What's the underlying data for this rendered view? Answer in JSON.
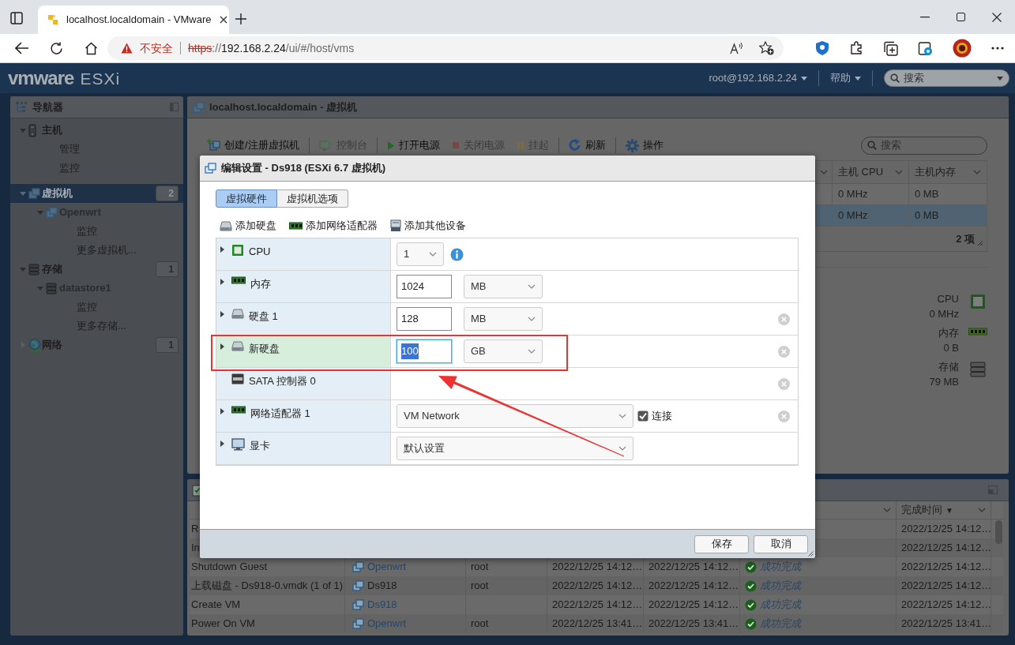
{
  "browser": {
    "tab": {
      "title": "localhost.localdomain - VMware"
    },
    "address": {
      "security": "不安全",
      "scheme": "https",
      "after_scheme": "://",
      "host": "192.168.2.24",
      "path": "/ui/#/host/vms"
    }
  },
  "header": {
    "logo": "vmware",
    "product": "ESXi",
    "user": "root@192.168.2.24",
    "help": "帮助",
    "search_placeholder": "搜索"
  },
  "navigator": {
    "title": "导航器",
    "items": [
      {
        "label": "主机",
        "kind": "host",
        "selected": false,
        "expanded": true,
        "children": [
          {
            "label": "管理",
            "selected": false
          },
          {
            "label": "监控",
            "selected": false
          }
        ]
      },
      {
        "label": "虚拟机",
        "kind": "vm",
        "selected": true,
        "expanded": true,
        "count": "2",
        "children": [
          {
            "label": "Openwrt",
            "kind": "vm",
            "selected": false,
            "expanded": true,
            "children": [
              {
                "label": "监控",
                "selected": false
              },
              {
                "label": "更多虚拟机...",
                "selected": false
              }
            ]
          }
        ]
      },
      {
        "label": "存储",
        "kind": "storage",
        "selected": false,
        "expanded": true,
        "count": "1",
        "children": [
          {
            "label": "datastore1",
            "kind": "storage",
            "selected": false,
            "expanded": true,
            "children": [
              {
                "label": "监控",
                "selected": false
              },
              {
                "label": "更多存储...",
                "selected": false
              }
            ]
          }
        ]
      },
      {
        "label": "网络",
        "kind": "network",
        "selected": false,
        "expanded": false,
        "count": "1"
      }
    ]
  },
  "main": {
    "title": "localhost.localdomain - 虚拟机",
    "toolbar": [
      {
        "label": "创建/注册虚拟机",
        "kind": "create",
        "disabled": false,
        "separator_after": true
      },
      {
        "label": "控制台",
        "kind": "console",
        "disabled": true,
        "separator_after": true
      },
      {
        "label": "打开电源",
        "kind": "power_on",
        "disabled": false,
        "separator_after": false
      },
      {
        "label": "关闭电源",
        "kind": "power_off",
        "disabled": true,
        "separator_after": false
      },
      {
        "label": "挂起",
        "kind": "suspend",
        "disabled": true,
        "separator_after": true
      },
      {
        "label": "刷新",
        "kind": "refresh",
        "disabled": false,
        "separator_after": true
      },
      {
        "label": "操作",
        "kind": "actions",
        "disabled": false,
        "separator_after": false
      }
    ],
    "search_placeholder": "搜索",
    "vm_table": {
      "columns": [
        "主机 CPU",
        "主机内存"
      ],
      "rows": [
        {
          "cells": [
            "0 MHz",
            "0 MB"
          ],
          "selected": false
        },
        {
          "cells": [
            "0 MHz",
            "0 MB"
          ],
          "selected": true
        }
      ],
      "footer": "2 项"
    },
    "summary": [
      {
        "label": "CPU",
        "value": "0 MHz",
        "kind": "cpu"
      },
      {
        "label": "内存",
        "value": "0 B",
        "kind": "memory"
      },
      {
        "label": "存储",
        "value": "79 MB",
        "kind": "storage"
      }
    ]
  },
  "tasks": {
    "columns": [
      {
        "label": "完成时间",
        "sort": "▼"
      }
    ],
    "rows": [
      {
        "task": "R",
        "completed": "2022/12/25 14:12…"
      },
      {
        "task": "In",
        "completed": "2022/12/25 14:12…"
      },
      {
        "task": "Shutdown Guest",
        "target": "Openwrt",
        "target_link": true,
        "initiator": "root",
        "queued": "2022/12/25 14:12…",
        "started": "2022/12/25 14:12…",
        "result": "成功完成",
        "completed": "2022/12/25 14:12…"
      },
      {
        "task": "上载磁盘 - Ds918-0.vmdk (1 of 1)",
        "target": "Ds918",
        "target_link": false,
        "initiator": "root",
        "queued": "2022/12/25 14:12…",
        "started": "2022/12/25 14:12…",
        "result": "成功完成",
        "completed": "2022/12/25 14:12…"
      },
      {
        "task": "Create VM",
        "target": "Ds918",
        "target_link": true,
        "queued": "2022/12/25 14:12…",
        "started": "2022/12/25 14:12…",
        "result": "成功完成",
        "completed": "2022/12/25 14:12…"
      },
      {
        "task": "Power On VM",
        "target": "Openwrt",
        "target_link": true,
        "initiator": "root",
        "queued": "2022/12/25 13:41…",
        "started": "2022/12/25 13:41…",
        "result": "成功完成",
        "completed": "2022/12/25 13:41…"
      }
    ]
  },
  "dialog": {
    "title": "编辑设置 - Ds918 (ESXi 6.7 虚拟机)",
    "tabs": [
      {
        "label": "虚拟硬件",
        "selected": true
      },
      {
        "label": "虚拟机选项",
        "selected": false
      }
    ],
    "add_actions": [
      {
        "label": "添加硬盘",
        "kind": "disk"
      },
      {
        "label": "添加网络适配器",
        "kind": "nic"
      },
      {
        "label": "添加其他设备",
        "kind": "other"
      }
    ],
    "devices": [
      {
        "label": "CPU",
        "kind": "cpu",
        "expandable": true,
        "highlighted": false,
        "removable": false,
        "controls": [
          {
            "kind": "count_select",
            "value": "1"
          },
          {
            "kind": "info"
          }
        ]
      },
      {
        "label": "内存",
        "kind": "memory",
        "expandable": true,
        "highlighted": false,
        "removable": false,
        "controls": [
          {
            "kind": "input",
            "value": "1024",
            "focused": false
          },
          {
            "kind": "unit_select",
            "value": "MB"
          }
        ]
      },
      {
        "label": "硬盘 1",
        "kind": "disk",
        "expandable": true,
        "highlighted": false,
        "removable": true,
        "controls": [
          {
            "kind": "input",
            "value": "128",
            "focused": false
          },
          {
            "kind": "unit_select",
            "value": "MB"
          }
        ]
      },
      {
        "label": "新硬盘",
        "kind": "disk",
        "expandable": true,
        "highlighted": true,
        "removable": true,
        "controls": [
          {
            "kind": "input",
            "value": "100",
            "focused": true
          },
          {
            "kind": "unit_select",
            "value": "GB"
          }
        ]
      },
      {
        "label": "SATA 控制器 0",
        "kind": "sata",
        "expandable": false,
        "highlighted": false,
        "removable": true
      },
      {
        "label": "网络适配器 1",
        "kind": "nic",
        "expandable": true,
        "highlighted": false,
        "removable": true,
        "controls": [
          {
            "kind": "dropdown",
            "value": "VM Network"
          },
          {
            "kind": "checkbox",
            "label": "连接",
            "checked": true
          }
        ]
      },
      {
        "label": "显卡",
        "kind": "display",
        "expandable": true,
        "highlighted": false,
        "removable": false,
        "controls": [
          {
            "kind": "dropdown",
            "value": "默认设置"
          }
        ]
      }
    ],
    "buttons": [
      {
        "label": "保存"
      },
      {
        "label": "取消"
      }
    ]
  },
  "annotations": [
    {
      "kind": "callout"
    }
  ]
}
